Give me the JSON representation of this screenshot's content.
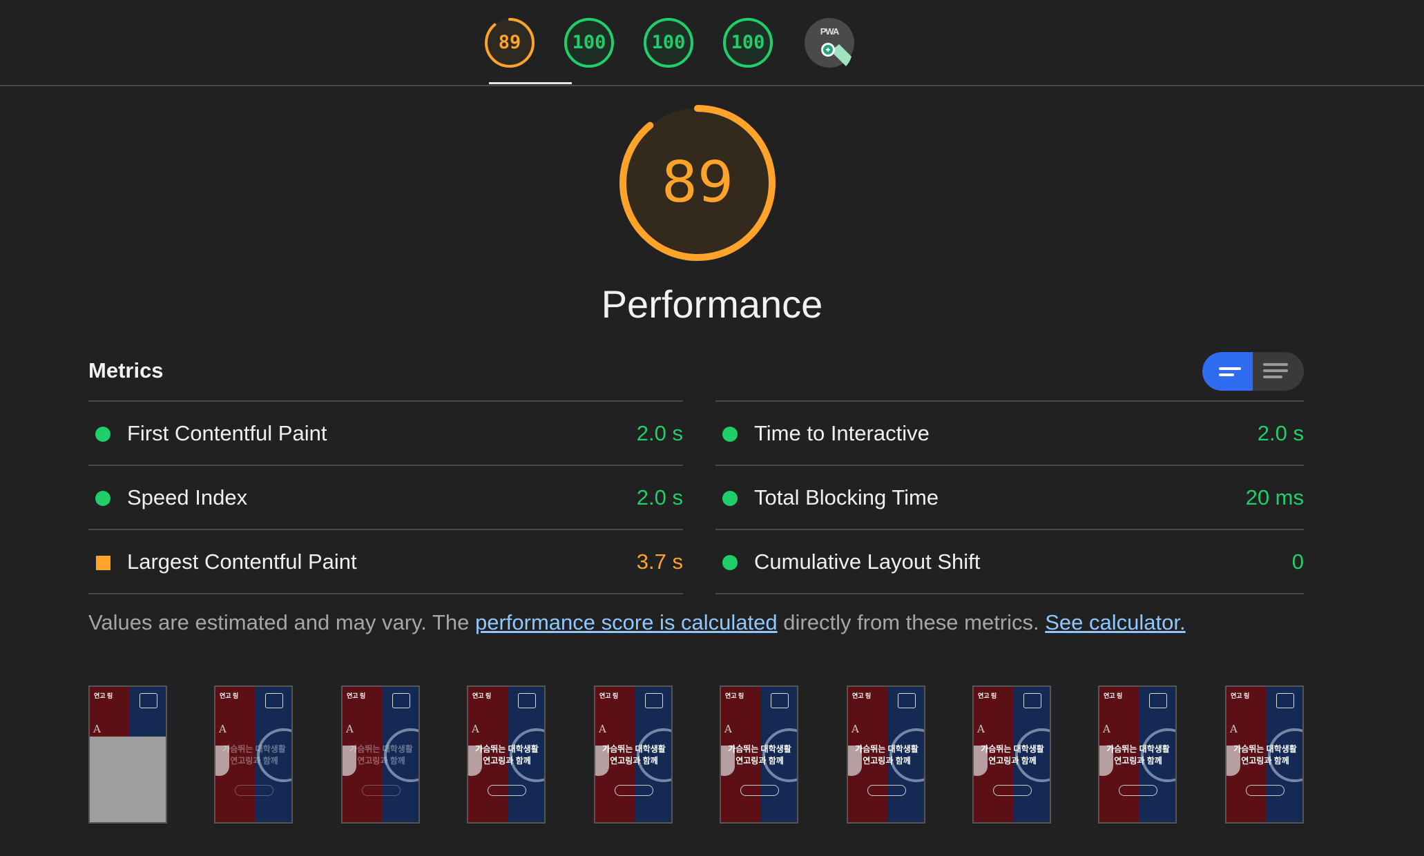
{
  "tabs": [
    {
      "score": "89",
      "rating": "average"
    },
    {
      "score": "100",
      "rating": "pass"
    },
    {
      "score": "100",
      "rating": "pass"
    },
    {
      "score": "100",
      "rating": "pass"
    },
    {
      "label": "PWA"
    }
  ],
  "main": {
    "score": "89",
    "score_fraction": 0.89,
    "title": "Performance"
  },
  "metrics": {
    "heading": "Metrics",
    "left": [
      {
        "label": "First Contentful Paint",
        "value": "2.0 s",
        "rating": "pass"
      },
      {
        "label": "Speed Index",
        "value": "2.0 s",
        "rating": "pass"
      },
      {
        "label": "Largest Contentful Paint",
        "value": "3.7 s",
        "rating": "average"
      }
    ],
    "right": [
      {
        "label": "Time to Interactive",
        "value": "2.0 s",
        "rating": "pass"
      },
      {
        "label": "Total Blocking Time",
        "value": "20 ms",
        "rating": "pass"
      },
      {
        "label": "Cumulative Layout Shift",
        "value": "0",
        "rating": "pass"
      }
    ]
  },
  "disclaimer": {
    "prefix": "Values are estimated and may vary. The ",
    "link1": "performance score is calculated",
    "middle": " directly from these metrics. ",
    "link2": "See calculator."
  },
  "filmstrip": {
    "header_text": "연고 링",
    "headline_line1": "가슴뛰는 대학생활",
    "headline_line2": "연고링과 함께",
    "frame_count": 10
  },
  "colors": {
    "pass": "#1fcf6a",
    "average": "#ffa32b",
    "accent": "#2f6cf2",
    "link": "#8fc7ff"
  }
}
